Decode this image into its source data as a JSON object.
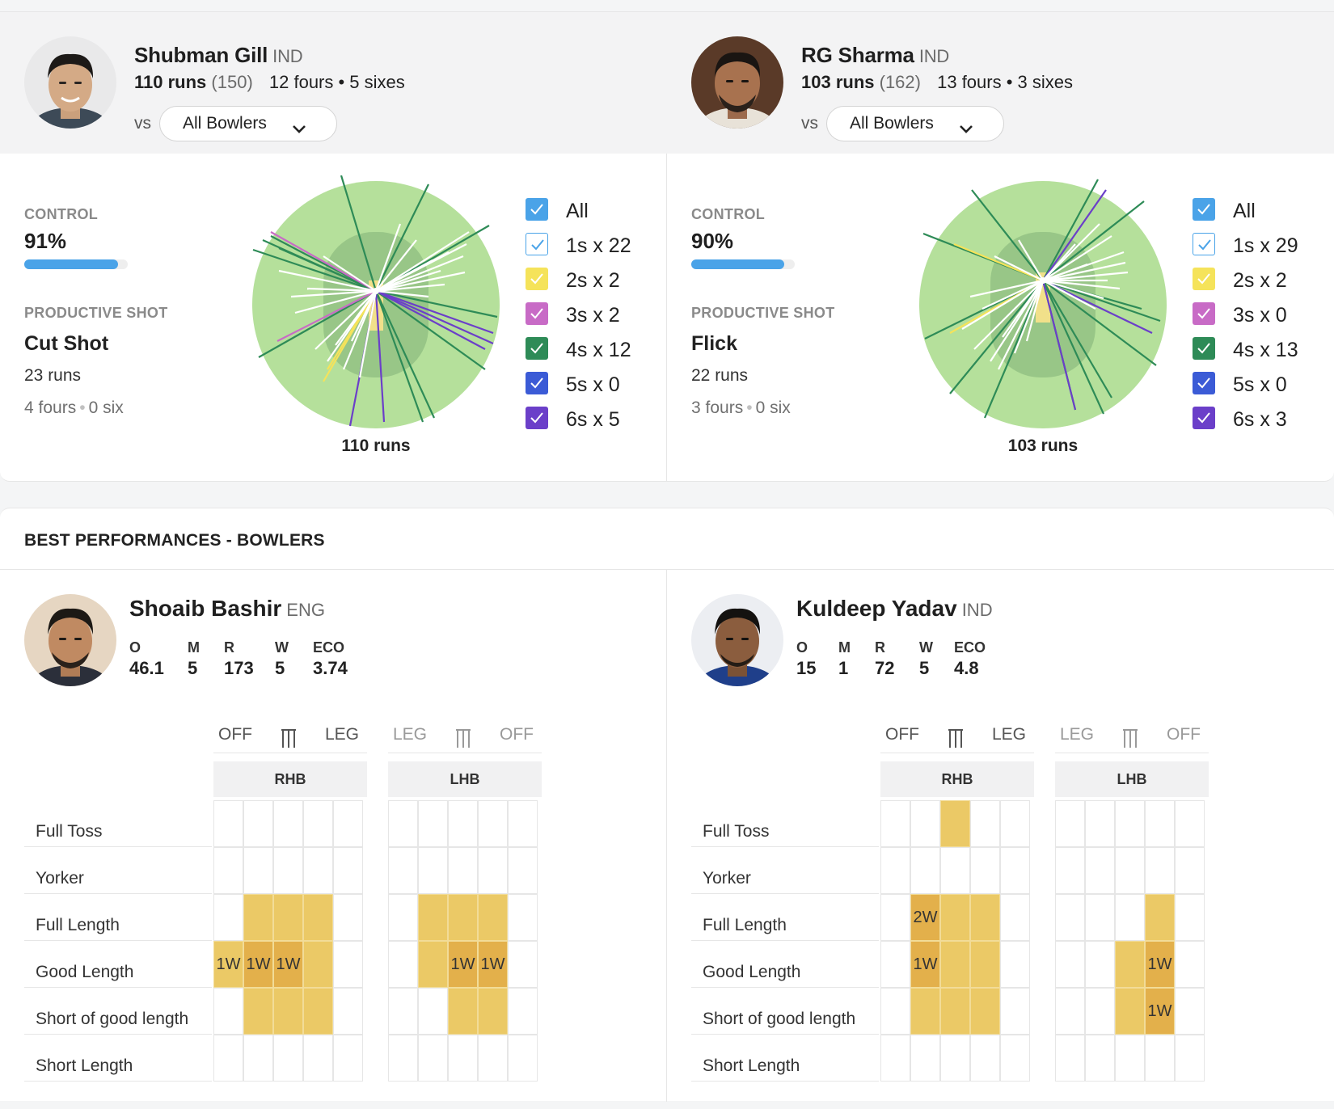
{
  "batters": [
    {
      "name": "Shubman Gill",
      "country": "IND",
      "runs": "110 runs",
      "balls": "(150)",
      "boundaries": "12 fours • 5 sixes",
      "vs_label": "vs",
      "bowler_filter": "All Bowlers",
      "control_label": "CONTROL",
      "control_value": "91%",
      "control_pct": 91,
      "productive_label": "PRODUCTIVE SHOT",
      "productive_shot": "Cut Shot",
      "productive_runs": "23 runs",
      "productive_fours": "4 fours",
      "productive_six": "0 six",
      "wagon_total": "110 runs",
      "legend": [
        {
          "label": "All",
          "color": "#4aa3e8"
        },
        {
          "label": "1s x 22",
          "color": "#ffffff"
        },
        {
          "label": "2s x 2",
          "color": "#f5e35a"
        },
        {
          "label": "3s x 2",
          "color": "#c86bc6"
        },
        {
          "label": "4s x 12",
          "color": "#2e8b57"
        },
        {
          "label": "5s x 0",
          "color": "#3b5bd6"
        },
        {
          "label": "6s x 5",
          "color": "#6b3fc9"
        }
      ]
    },
    {
      "name": "RG Sharma",
      "country": "IND",
      "runs": "103 runs",
      "balls": "(162)",
      "boundaries": "13 fours • 3 sixes",
      "vs_label": "vs",
      "bowler_filter": "All Bowlers",
      "control_label": "CONTROL",
      "control_value": "90%",
      "control_pct": 90,
      "productive_label": "PRODUCTIVE SHOT",
      "productive_shot": "Flick",
      "productive_runs": "22 runs",
      "productive_fours": "3 fours",
      "productive_six": "0 six",
      "wagon_total": "103 runs",
      "legend": [
        {
          "label": "All",
          "color": "#4aa3e8"
        },
        {
          "label": "1s x 29",
          "color": "#ffffff"
        },
        {
          "label": "2s x 2",
          "color": "#f5e35a"
        },
        {
          "label": "3s x 0",
          "color": "#c86bc6"
        },
        {
          "label": "4s x 13",
          "color": "#2e8b57"
        },
        {
          "label": "5s x 0",
          "color": "#3b5bd6"
        },
        {
          "label": "6s x 3",
          "color": "#6b3fc9"
        }
      ]
    }
  ],
  "bowling_section_title": "BEST PERFORMANCES - BOWLERS",
  "pitch_map_labels": {
    "off": "OFF",
    "leg": "LEG",
    "rhb": "RHB",
    "lhb": "LHB"
  },
  "length_labels": [
    "Full Toss",
    "Yorker",
    "Full Length",
    "Good Length",
    "Short of good length",
    "Short Length"
  ],
  "stat_headers": [
    "O",
    "M",
    "R",
    "W",
    "ECO"
  ],
  "bowlers": [
    {
      "name": "Shoaib Bashir",
      "country": "ENG",
      "stats": [
        "46.1",
        "5",
        "173",
        "5",
        "3.74"
      ]
    },
    {
      "name": "Kuldeep Yadav",
      "country": "IND",
      "stats": [
        "15",
        "1",
        "72",
        "5",
        "4.8"
      ]
    }
  ]
}
